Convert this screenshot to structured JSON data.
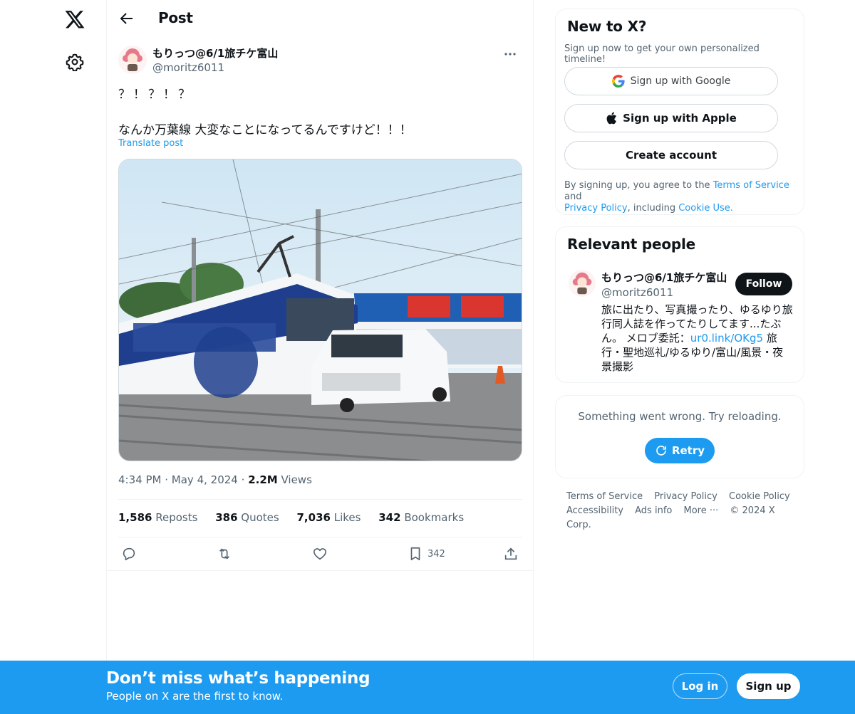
{
  "header": {
    "title": "Post"
  },
  "post": {
    "author_name": "もりっつ@6/1旅チケ富山",
    "author_handle": "@moritz6011",
    "text_line1": "？！？！？",
    "text_line2": "なんか万葉線 大変なことになってるんですけど！！！",
    "translate_label": "Translate post",
    "time": "4:34 PM",
    "date": "May 4, 2024",
    "views_count": "2.2M",
    "views_label": "Views",
    "sep": "·",
    "stats": {
      "reposts_count": "1,586",
      "reposts_label": "Reposts",
      "quotes_count": "386",
      "quotes_label": "Quotes",
      "likes_count": "7,036",
      "likes_label": "Likes",
      "bookmarks_count": "342",
      "bookmarks_label": "Bookmarks"
    },
    "actions": {
      "bookmark_count": "342"
    }
  },
  "signup_card": {
    "title": "New to X?",
    "subtitle": "Sign up now to get your own personalized timeline!",
    "google_label": "Sign up with Google",
    "apple_label": "Sign up with Apple",
    "create_label": "Create account",
    "legal_prefix": "By signing up, you agree to the",
    "terms_link": "Terms of Service",
    "legal_and": "and",
    "privacy_link": "Privacy Policy",
    "legal_including": ", including",
    "cookie_link": "Cookie Use."
  },
  "relevant": {
    "title": "Relevant people",
    "name": "もりっつ@6/1旅チケ富山",
    "handle": "@moritz6011",
    "follow_label": "Follow",
    "bio_text": "旅に出たり、写真撮ったり、ゆるゆり旅行同人誌を作ってたりしてます...たぶん。 メロブ委託：",
    "bio_link": "ur0.link/OKg5",
    "bio_tail": " 旅行・聖地巡礼/ゆるゆり/富山/風景・夜景撮影"
  },
  "error_card": {
    "message": "Something went wrong. Try reloading.",
    "retry_label": "Retry"
  },
  "footer": {
    "links": [
      "Terms of Service",
      "Privacy Policy",
      "Cookie Policy",
      "Accessibility",
      "Ads info",
      "More ···",
      "© 2024 X Corp."
    ]
  },
  "banner": {
    "title": "Don’t miss what’s happening",
    "subtitle": "People on X are the first to know.",
    "login_label": "Log in",
    "signup_label": "Sign up"
  },
  "colors": {
    "accent": "#1d9bf0",
    "text": "#0f1419",
    "muted": "#536471",
    "border": "#eff3f4"
  }
}
